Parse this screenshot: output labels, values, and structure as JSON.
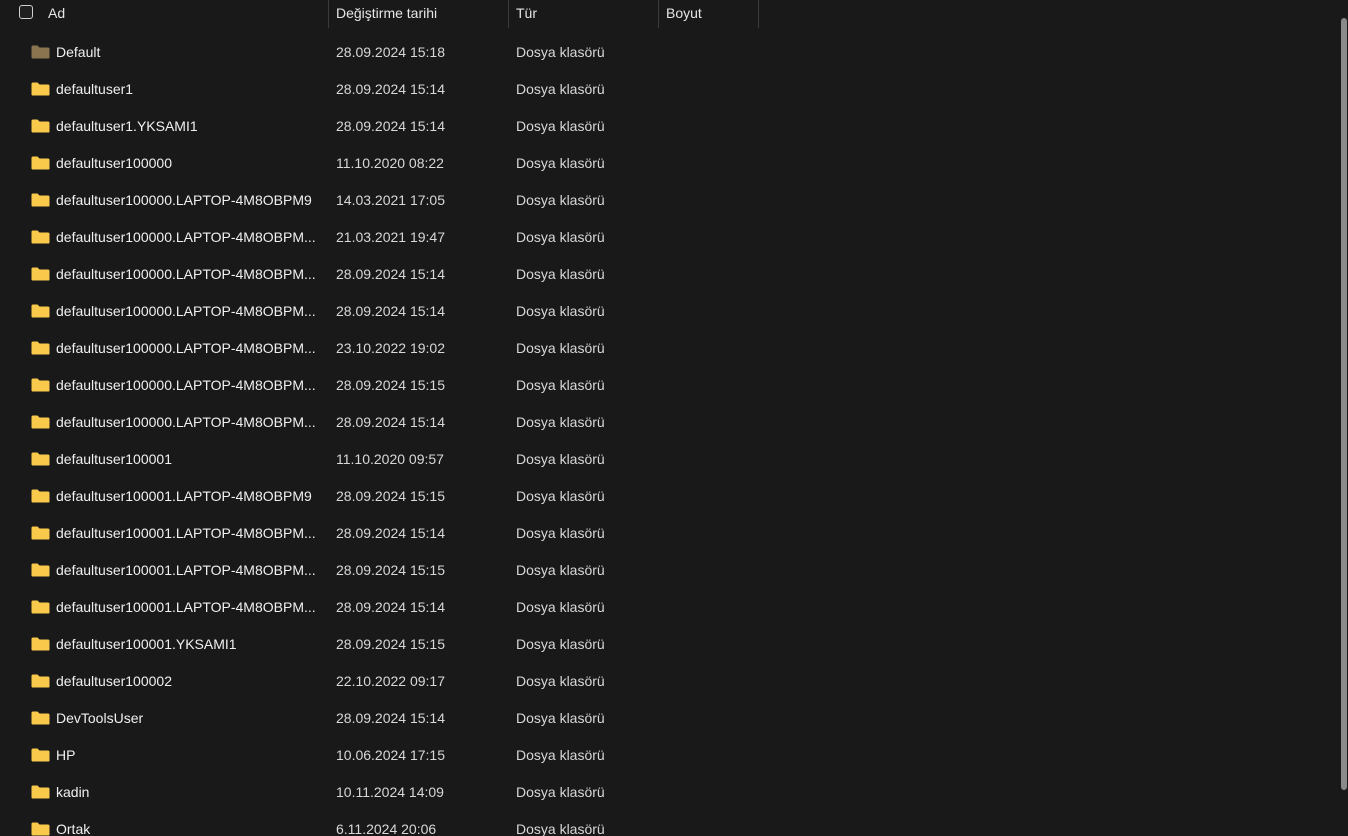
{
  "columns": {
    "name": "Ad",
    "date": "Değiştirme tarihi",
    "type": "Tür",
    "size": "Boyut"
  },
  "sort_indicator": "^",
  "folder_color_default": "#8a7450",
  "folder_color": "#f8c94a",
  "rows": [
    {
      "name": "Default",
      "date": "28.09.2024 15:18",
      "type": "Dosya klasörü",
      "icon": "folder-dim"
    },
    {
      "name": "defaultuser1",
      "date": "28.09.2024 15:14",
      "type": "Dosya klasörü",
      "icon": "folder"
    },
    {
      "name": "defaultuser1.YKSAMI1",
      "date": "28.09.2024 15:14",
      "type": "Dosya klasörü",
      "icon": "folder"
    },
    {
      "name": "defaultuser100000",
      "date": "11.10.2020 08:22",
      "type": "Dosya klasörü",
      "icon": "folder"
    },
    {
      "name": "defaultuser100000.LAPTOP-4M8OBPM9",
      "date": "14.03.2021 17:05",
      "type": "Dosya klasörü",
      "icon": "folder"
    },
    {
      "name": "defaultuser100000.LAPTOP-4M8OBPM...",
      "date": "21.03.2021 19:47",
      "type": "Dosya klasörü",
      "icon": "folder"
    },
    {
      "name": "defaultuser100000.LAPTOP-4M8OBPM...",
      "date": "28.09.2024 15:14",
      "type": "Dosya klasörü",
      "icon": "folder"
    },
    {
      "name": "defaultuser100000.LAPTOP-4M8OBPM...",
      "date": "28.09.2024 15:14",
      "type": "Dosya klasörü",
      "icon": "folder"
    },
    {
      "name": "defaultuser100000.LAPTOP-4M8OBPM...",
      "date": "23.10.2022 19:02",
      "type": "Dosya klasörü",
      "icon": "folder"
    },
    {
      "name": "defaultuser100000.LAPTOP-4M8OBPM...",
      "date": "28.09.2024 15:15",
      "type": "Dosya klasörü",
      "icon": "folder"
    },
    {
      "name": "defaultuser100000.LAPTOP-4M8OBPM...",
      "date": "28.09.2024 15:14",
      "type": "Dosya klasörü",
      "icon": "folder"
    },
    {
      "name": "defaultuser100001",
      "date": "11.10.2020 09:57",
      "type": "Dosya klasörü",
      "icon": "folder"
    },
    {
      "name": "defaultuser100001.LAPTOP-4M8OBPM9",
      "date": "28.09.2024 15:15",
      "type": "Dosya klasörü",
      "icon": "folder"
    },
    {
      "name": "defaultuser100001.LAPTOP-4M8OBPM...",
      "date": "28.09.2024 15:14",
      "type": "Dosya klasörü",
      "icon": "folder"
    },
    {
      "name": "defaultuser100001.LAPTOP-4M8OBPM...",
      "date": "28.09.2024 15:15",
      "type": "Dosya klasörü",
      "icon": "folder"
    },
    {
      "name": "defaultuser100001.LAPTOP-4M8OBPM...",
      "date": "28.09.2024 15:14",
      "type": "Dosya klasörü",
      "icon": "folder"
    },
    {
      "name": "defaultuser100001.YKSAMI1",
      "date": "28.09.2024 15:15",
      "type": "Dosya klasörü",
      "icon": "folder"
    },
    {
      "name": "defaultuser100002",
      "date": "22.10.2022 09:17",
      "type": "Dosya klasörü",
      "icon": "folder"
    },
    {
      "name": "DevToolsUser",
      "date": "28.09.2024 15:14",
      "type": "Dosya klasörü",
      "icon": "folder"
    },
    {
      "name": "HP",
      "date": "10.06.2024 17:15",
      "type": "Dosya klasörü",
      "icon": "folder"
    },
    {
      "name": "kadin",
      "date": "10.11.2024 14:09",
      "type": "Dosya klasörü",
      "icon": "folder"
    },
    {
      "name": "Ortak",
      "date": "6.11.2024 20:06",
      "type": "Dosya klasörü",
      "icon": "folder"
    }
  ]
}
